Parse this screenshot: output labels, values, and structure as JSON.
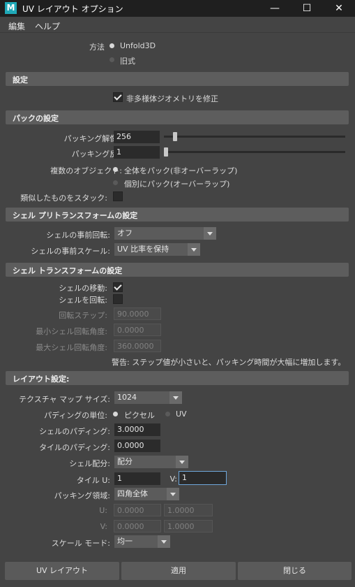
{
  "window": {
    "title": "UV レイアウト オプション",
    "icon_letter": "M",
    "minimize": "—",
    "maximize": "☐",
    "close": "✕"
  },
  "menu": {
    "edit": "編集",
    "help": "ヘルプ"
  },
  "method": {
    "label": "方法",
    "opt1": "Unfold3D",
    "opt2": "旧式",
    "selected": "Unfold3D"
  },
  "settings": {
    "header": "設定",
    "fix_nonmanifold": "非多様体ジオメトリを修正",
    "fix_nonmanifold_checked": true
  },
  "pack": {
    "header": "パックの設定",
    "resolution_label": "パッキング解像度:",
    "resolution_value": "256",
    "resolution_slider_fraction": 0.06,
    "iterations_label": "パッキング反復:",
    "iterations_value": "1",
    "iterations_slider_fraction": 0.01,
    "multi_objects_label": "複数のオブジェクト:",
    "opt_all": "全体をパック(非オーバーラップ)",
    "opt_each": "個別にパック(オーバーラップ)",
    "stack_similar_label": "類似したものをスタック:",
    "stack_similar_checked": false
  },
  "pretransform": {
    "header": "シェル プリトランスフォームの設定",
    "prerotate_label": "シェルの事前回転:",
    "prerotate_value": "オフ",
    "prescale_label": "シェルの事前スケール:",
    "prescale_value": "UV 比率を保持"
  },
  "transform": {
    "header": "シェル トランスフォームの設定",
    "move_label": "シェルの移動:",
    "move_checked": true,
    "rotate_label": "シェルを回転:",
    "rotate_checked": false,
    "rotate_step_label": "回転ステップ:",
    "rotate_step_value": "90.0000",
    "min_angle_label": "最小シェル回転角度:",
    "min_angle_value": "0.0000",
    "max_angle_label": "最大シェル回転角度:",
    "max_angle_value": "360.0000",
    "warning": "警告: ステップ値が小さいと、パッキング時間が大幅に増加します。"
  },
  "layout": {
    "header": "レイアウト設定:",
    "tex_size_label": "テクスチャ マップ サイズ:",
    "tex_size_value": "1024",
    "padding_unit_label": "パディングの単位:",
    "unit_pixel": "ピクセル",
    "unit_uv": "UV",
    "shell_padding_label": "シェルのパディング:",
    "shell_padding_value": "3.0000",
    "tile_padding_label": "タイルのパディング:",
    "tile_padding_value": "0.0000",
    "distribution_label": "シェル配分:",
    "distribution_value": "配分",
    "tile_u_label": "タイル U:",
    "tile_u_value": "1",
    "tile_v_label": "V:",
    "tile_v_value": "1",
    "region_label": "パッキング領域:",
    "region_value": "四角全体",
    "u_label": "U:",
    "u_min": "0.0000",
    "u_max": "1.0000",
    "v_label": "V:",
    "v_min": "0.0000",
    "v_max": "1.0000",
    "scale_mode_label": "スケール モード:",
    "scale_mode_value": "均一"
  },
  "buttons": {
    "uv_layout": "UV レイアウト",
    "apply": "適用",
    "close": "閉じる"
  }
}
